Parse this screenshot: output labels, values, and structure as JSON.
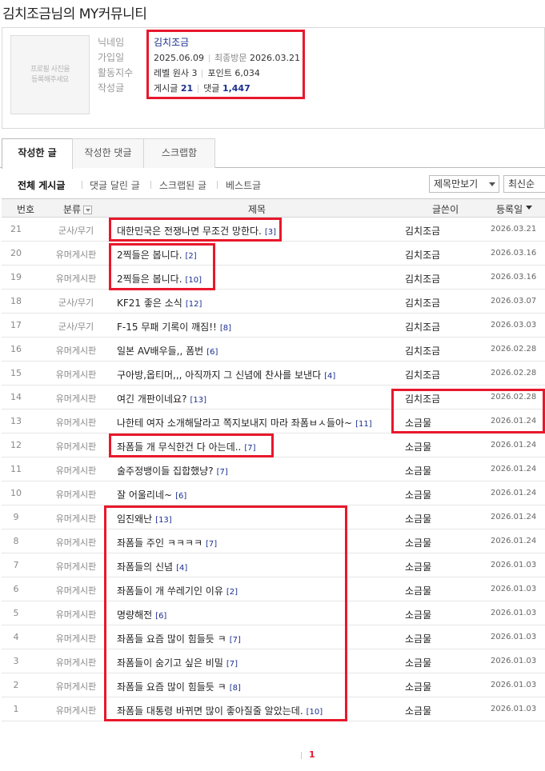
{
  "page": {
    "title": "김치조금님의 MY커뮤니티"
  },
  "profile": {
    "avatar_text": "프로필 사진을\n등록해주세요",
    "labels": [
      "닉네임",
      "가입일",
      "활동지수",
      "작성글"
    ],
    "nickname": "김치조금",
    "joined_label": "",
    "joined": "2025.06.09",
    "last_visit_label": "최종방문",
    "last_visit": "2026.03.21",
    "level": "레벨 원사 3",
    "points": "포인트 6,034",
    "posts_label": "게시글",
    "posts_count": "21",
    "comments_label": "댓글",
    "comments_count": "1,447"
  },
  "tabs": [
    "작성한 글",
    "작성한 댓글",
    "스크랩함"
  ],
  "filters": [
    "전체 게시글",
    "댓글 달린 글",
    "스크랩된 글",
    "베스트글"
  ],
  "selects": {
    "view": "제목만보기",
    "sort": "최신순"
  },
  "table": {
    "headers": {
      "no": "번호",
      "category": "분류",
      "title": "제목",
      "author": "글쓴이",
      "date": "등록일"
    },
    "rows": [
      {
        "no": "21",
        "category": "군사/무기",
        "title": "대한민국은 전쟁나면 무조건 망한다.",
        "comments": "[3]",
        "author": "김치조금",
        "date": "2026.03.21"
      },
      {
        "no": "20",
        "category": "유머게시판",
        "title": "2찍들은 봅니다.",
        "comments": "[2]",
        "author": "김치조금",
        "date": "2026.03.16"
      },
      {
        "no": "19",
        "category": "유머게시판",
        "title": "2찍들은 봅니다.",
        "comments": "[10]",
        "author": "김치조금",
        "date": "2026.03.16"
      },
      {
        "no": "18",
        "category": "군사/무기",
        "title": "KF21 좋은 소식",
        "comments": "[12]",
        "author": "김치조금",
        "date": "2026.03.07"
      },
      {
        "no": "17",
        "category": "군사/무기",
        "title": "F-15 무패 기록이 깨짐!!",
        "comments": "[8]",
        "author": "김치조금",
        "date": "2026.03.03"
      },
      {
        "no": "16",
        "category": "유머게시판",
        "title": "일본 AV배우들,, 폼번",
        "comments": "[6]",
        "author": "김치조금",
        "date": "2026.02.28"
      },
      {
        "no": "15",
        "category": "유머게시판",
        "title": "구아방,옵티머,,, 아직까지 그 신념에 찬사를 보낸다",
        "comments": "[4]",
        "author": "김치조금",
        "date": "2026.02.28"
      },
      {
        "no": "14",
        "category": "유머게시판",
        "title": "여긴 개판이네요?",
        "comments": "[13]",
        "author": "김치조금",
        "date": "2026.02.28"
      },
      {
        "no": "13",
        "category": "유머게시판",
        "title": "나한테 여자 소개해달라고 쪽지보내지 마라 좌폼ㅂㅅ들아~",
        "comments": "[11]",
        "author": "소금물",
        "date": "2026.01.24"
      },
      {
        "no": "12",
        "category": "유머게시판",
        "title": "좌폼들 개 무식한건 다 아는데..",
        "comments": "[7]",
        "author": "소금물",
        "date": "2026.01.24"
      },
      {
        "no": "11",
        "category": "유머게시판",
        "title": "술주정뱅이들 집합했냥?",
        "comments": "[7]",
        "author": "소금물",
        "date": "2026.01.24"
      },
      {
        "no": "10",
        "category": "유머게시판",
        "title": "잘 어울리네~",
        "comments": "[6]",
        "author": "소금물",
        "date": "2026.01.24"
      },
      {
        "no": "9",
        "category": "유머게시판",
        "title": "임진왜난",
        "comments": "[13]",
        "author": "소금물",
        "date": "2026.01.24"
      },
      {
        "no": "8",
        "category": "유머게시판",
        "title": "좌폼들 주인 ㅋㅋㅋㅋ",
        "comments": "[7]",
        "author": "소금물",
        "date": "2026.01.24"
      },
      {
        "no": "7",
        "category": "유머게시판",
        "title": "좌폼들의 신념",
        "comments": "[4]",
        "author": "소금물",
        "date": "2026.01.03"
      },
      {
        "no": "6",
        "category": "유머게시판",
        "title": "좌폼들이 개 쑤레기인 이유",
        "comments": "[2]",
        "author": "소금물",
        "date": "2026.01.03"
      },
      {
        "no": "5",
        "category": "유머게시판",
        "title": "명량해전",
        "comments": "[6]",
        "author": "소금물",
        "date": "2026.01.03"
      },
      {
        "no": "4",
        "category": "유머게시판",
        "title": "좌폼들 요즘 많이 힘들듯 ㅋ",
        "comments": "[7]",
        "author": "소금물",
        "date": "2026.01.03"
      },
      {
        "no": "3",
        "category": "유머게시판",
        "title": "좌폼들이 숨기고 싶은 비밀",
        "comments": "[7]",
        "author": "소금물",
        "date": "2026.01.03"
      },
      {
        "no": "2",
        "category": "유머게시판",
        "title": "좌폼들 요즘 많이 힘들듯 ㅋ",
        "comments": "[8]",
        "author": "소금물",
        "date": "2026.01.03"
      },
      {
        "no": "1",
        "category": "유머게시판",
        "title": "좌폼들 대통령 바뀌면 많이 좋아질줄 알았는데.",
        "comments": "[10]",
        "author": "소금물",
        "date": "2026.01.03"
      }
    ]
  },
  "pagination": {
    "current": "1"
  },
  "colors": {
    "highlight": "#e8182c",
    "link_blue": "#1a2f8f"
  }
}
